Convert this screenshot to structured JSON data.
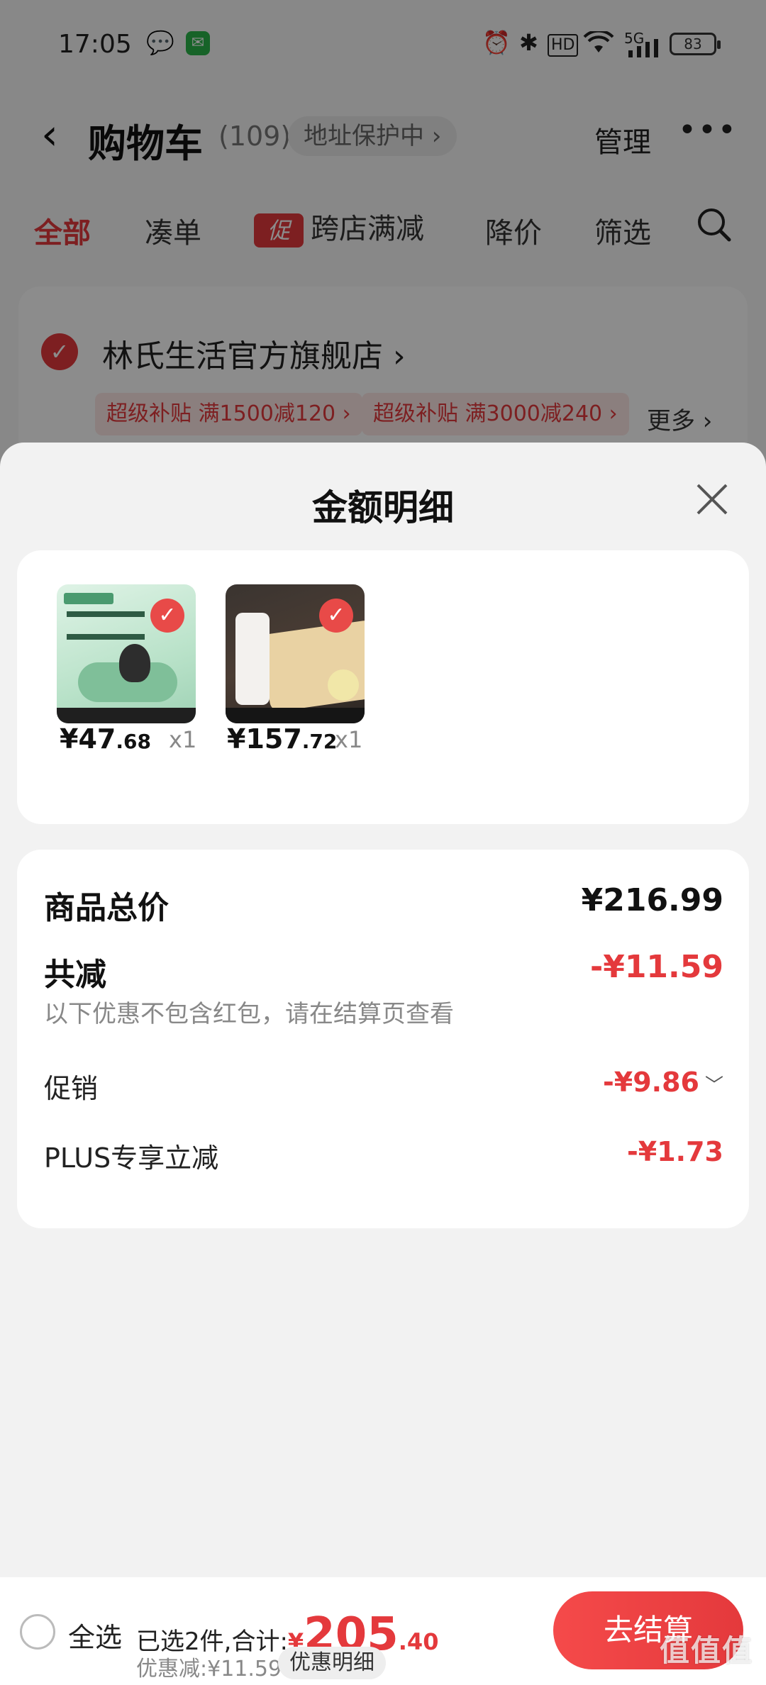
{
  "status_bar": {
    "time": "17:05",
    "battery": "83",
    "hd_label": "HD",
    "network_label": "5G"
  },
  "nav": {
    "title": "购物车",
    "count": "(109)",
    "address_protection": "地址保护中 ›",
    "manage": "管理",
    "more": "•••"
  },
  "tabs": {
    "all": "全部",
    "bundle": "凑单",
    "promo_badge": "促",
    "cross_store": "跨店满减",
    "price_drop": "降价",
    "filter": "筛选"
  },
  "shop": {
    "name": "林氏生活官方旗舰店 ›",
    "coupons": [
      "超级补贴  满1500减120 ›",
      "超级补贴  满3000减240 ›"
    ],
    "more": "更多 ›"
  },
  "sheet": {
    "title": "金额明细",
    "products": [
      {
        "price_int": "¥47",
        "price_dec": ".68",
        "qty": "x1"
      },
      {
        "price_int": "¥157",
        "price_dec": ".72",
        "qty": "x1"
      }
    ],
    "summary": {
      "total_label": "商品总价",
      "total_value": "¥216.99",
      "discount_label": "共减",
      "discount_value": "-¥11.59",
      "note": "以下优惠不包含红包，请在结算页查看",
      "promo_label": "促销",
      "promo_value": "-¥9.86",
      "plus_label": "PLUS专享立减",
      "plus_value": "-¥1.73"
    }
  },
  "bottom_bar": {
    "select_all": "全选",
    "selected_prefix": "已选2件,合计:",
    "total_yen": "¥",
    "total_int": "205",
    "total_dec": ".40",
    "discount_text": "优惠减:¥11.59",
    "detail_button": "优惠明细",
    "checkout": "去结算"
  },
  "watermark": {
    "glyphs": "值值值",
    "url": "zhizhizhi.com"
  },
  "colors": {
    "accent": "#e4393c",
    "overlay": "rgba(0,0,0,0.45)"
  }
}
